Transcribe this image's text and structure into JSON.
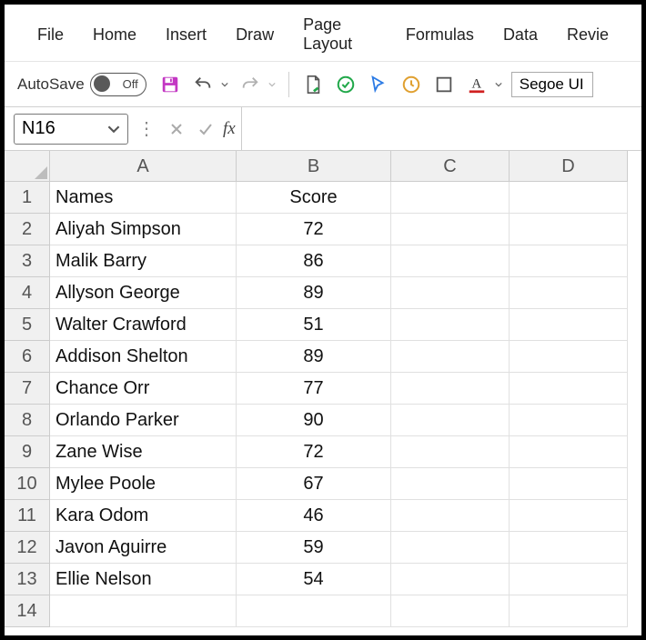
{
  "tabs": [
    "File",
    "Home",
    "Insert",
    "Draw",
    "Page Layout",
    "Formulas",
    "Data",
    "Revie"
  ],
  "toolbar": {
    "autosave_label": "AutoSave",
    "autosave_state": "Off",
    "font_name": "Segoe UI"
  },
  "formula_bar": {
    "name_box": "N16",
    "fx_label": "fx",
    "formula": ""
  },
  "columns": [
    "A",
    "B",
    "C",
    "D"
  ],
  "rows": [
    {
      "n": 1,
      "a": "Names",
      "b": "Score"
    },
    {
      "n": 2,
      "a": "Aliyah Simpson",
      "b": "72"
    },
    {
      "n": 3,
      "a": "Malik Barry",
      "b": "86"
    },
    {
      "n": 4,
      "a": "Allyson George",
      "b": "89"
    },
    {
      "n": 5,
      "a": "Walter Crawford",
      "b": "51"
    },
    {
      "n": 6,
      "a": "Addison Shelton",
      "b": "89"
    },
    {
      "n": 7,
      "a": "Chance Orr",
      "b": "77"
    },
    {
      "n": 8,
      "a": "Orlando Parker",
      "b": "90"
    },
    {
      "n": 9,
      "a": "Zane Wise",
      "b": "72"
    },
    {
      "n": 10,
      "a": "Mylee Poole",
      "b": "67"
    },
    {
      "n": 11,
      "a": "Kara Odom",
      "b": "46"
    },
    {
      "n": 12,
      "a": "Javon Aguirre",
      "b": "59"
    },
    {
      "n": 13,
      "a": "Ellie Nelson",
      "b": "54"
    },
    {
      "n": 14,
      "a": "",
      "b": ""
    }
  ],
  "chart_data": {
    "type": "table",
    "columns": [
      "Names",
      "Score"
    ],
    "records": [
      {
        "Names": "Aliyah Simpson",
        "Score": 72
      },
      {
        "Names": "Malik Barry",
        "Score": 86
      },
      {
        "Names": "Allyson George",
        "Score": 89
      },
      {
        "Names": "Walter Crawford",
        "Score": 51
      },
      {
        "Names": "Addison Shelton",
        "Score": 89
      },
      {
        "Names": "Chance Orr",
        "Score": 77
      },
      {
        "Names": "Orlando Parker",
        "Score": 90
      },
      {
        "Names": "Zane Wise",
        "Score": 72
      },
      {
        "Names": "Mylee Poole",
        "Score": 67
      },
      {
        "Names": "Kara Odom",
        "Score": 46
      },
      {
        "Names": "Javon Aguirre",
        "Score": 59
      },
      {
        "Names": "Ellie Nelson",
        "Score": 54
      }
    ]
  }
}
